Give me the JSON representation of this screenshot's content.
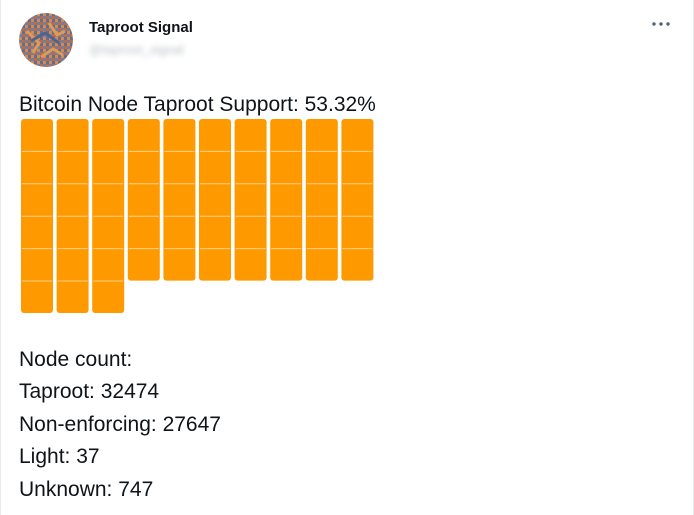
{
  "author": {
    "name": "Taproot Signal",
    "handle": "@taproot_signal"
  },
  "more_menu_icon": "more-horizontal-icon",
  "headline": "Bitcoin Node Taproot Support: 53.32%",
  "progress": {
    "percent": 53.32,
    "color": "#ff9900",
    "columns_total": 10,
    "rows_total": 6,
    "column_filled_blocks": [
      6,
      6,
      6,
      5,
      5,
      5,
      5,
      5,
      5,
      5
    ]
  },
  "stats": {
    "heading": "Node count:",
    "lines": [
      "Taproot: 32474",
      "Non-enforcing: 27647",
      "Light: 37",
      "Unknown: 747"
    ]
  }
}
